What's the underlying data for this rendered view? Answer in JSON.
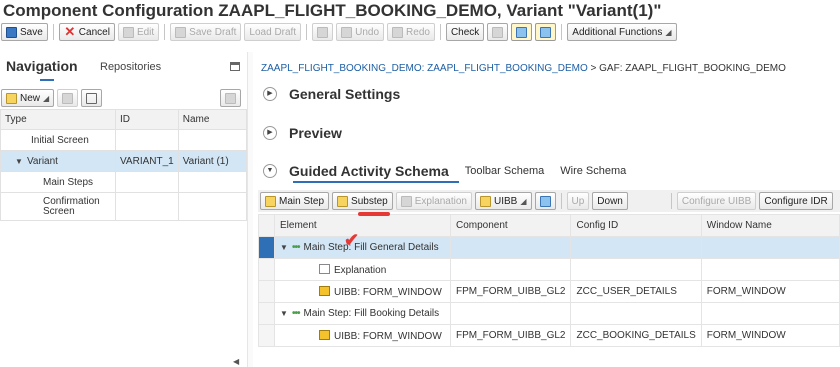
{
  "title": "Component Configuration ZAAPL_FLIGHT_BOOKING_DEMO, Variant \"Variant(1)\"",
  "toolbar": {
    "save": "Save",
    "cancel": "Cancel",
    "edit": "Edit",
    "save_draft": "Save Draft",
    "load_draft": "Load Draft",
    "undo": "Undo",
    "redo": "Redo",
    "check": "Check",
    "additional": "Additional Functions"
  },
  "nav": {
    "tab_navigation": "Navigation",
    "tab_repositories": "Repositories",
    "new_button": "New",
    "columns": [
      "Type",
      "ID",
      "Name"
    ],
    "rows": [
      {
        "type": "Initial Screen",
        "id": "",
        "name": ""
      },
      {
        "type": "Variant",
        "id": "VARIANT_1",
        "name": "Variant (1)"
      },
      {
        "type": "Main Steps",
        "id": "",
        "name": ""
      },
      {
        "type": "Confirmation Screen",
        "id": "",
        "name": ""
      }
    ]
  },
  "breadcrumb": {
    "link": "ZAAPL_FLIGHT_BOOKING_DEMO: ZAAPL_FLIGHT_BOOKING_DEMO",
    "sep": ">",
    "current": "GAF: ZAAPL_FLIGHT_BOOKING_DEMO"
  },
  "sections": {
    "general": "General Settings",
    "preview": "Preview",
    "gas": "Guided Activity Schema",
    "toolbar_schema": "Toolbar Schema",
    "wire_schema": "Wire Schema"
  },
  "gas_toolbar": {
    "main_step": "Main Step",
    "substep": "Substep",
    "explanation": "Explanation",
    "uibb": "UIBB",
    "up": "Up",
    "down": "Down",
    "configure_uibb": "Configure UIBB",
    "configure_idr": "Configure IDR"
  },
  "grid": {
    "columns": [
      "Element",
      "Component",
      "Config ID",
      "Window Name"
    ],
    "rows": [
      {
        "element": "Main Step: Fill General Details",
        "component": "",
        "config": "",
        "window": ""
      },
      {
        "element": "Explanation",
        "component": "",
        "config": "",
        "window": ""
      },
      {
        "element": "UIBB: FORM_WINDOW",
        "component": "FPM_FORM_UIBB_GL2",
        "config": "ZCC_USER_DETAILS",
        "window": "FORM_WINDOW"
      },
      {
        "element": "Main Step: Fill Booking Details",
        "component": "",
        "config": "",
        "window": ""
      },
      {
        "element": "UIBB: FORM_WINDOW",
        "component": "FPM_FORM_UIBB_GL2",
        "config": "ZCC_BOOKING_DETAILS",
        "window": "FORM_WINDOW"
      }
    ]
  },
  "colors": {
    "accent": "#2f6fb5",
    "selected_row": "#d3e6f5",
    "annotation_red": "#e53935"
  }
}
